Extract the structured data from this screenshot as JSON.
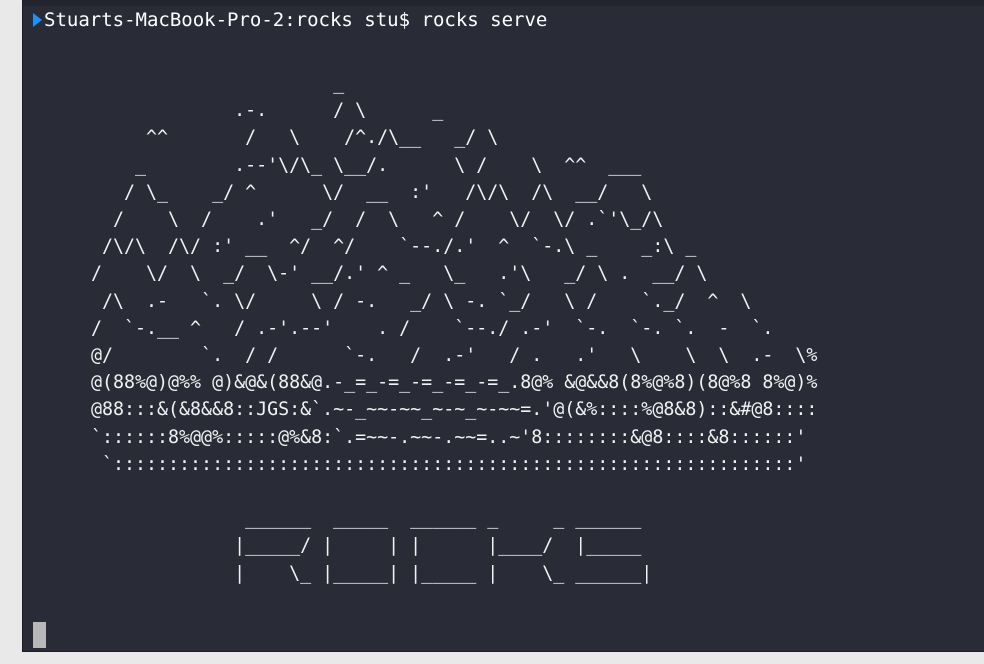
{
  "terminal": {
    "prompt": {
      "host": "Stuarts-MacBook-Pro-2:rocks stu$",
      "command": "rocks serve"
    },
    "art_lines": [
      "                      _",
      "             .-.      / \\      _",
      "     ^^       /   \\    /^./\\__   _/ \\",
      "    _        .--'\\/\\_ \\__/.      \\ /    \\  ^^  ___",
      "   / \\_    _/ ^      \\/  __  :'   /\\/\\  /\\  __/   \\",
      "  /    \\  /    .'   _/  /  \\   ^ /    \\/  \\/ .`'\\_/\\",
      " /\\/\\  /\\/ :' __  ^/  ^/    `--./.'  ^  `-.\\ _    _:\\ _",
      "/    \\/  \\  _/  \\-' __/.' ^ _   \\_   .'\\   _/ \\ .  __/ \\",
      " /\\  .-   `. \\/     \\ / -.   _/ \\ -. `_/   \\ /    `._/  ^  \\",
      "/  `-.__ ^   / .-'.--'    . /    `--./ .-'  `-.  `-. `.  -  `.",
      "@/        `.  / /      `-.   /  .-'   / .   .'   \\    \\  \\  .-  \\%",
      "@(88%@)@%% @)&@&(88&@.-_=_-=_-=_-=_-=_.8@% &@&&8(8%@%8)(8@%8 8%@)%",
      "@88:::&(&8&&8::JGS:&`.~-_~~-~~_~-~_~-~~=.'@(&%::::%@8&8)::&#@8::::",
      "`::::::8%@@%:::::@%&8:`.=~~-.~~-.~~=..~'8::::::::&@8::::&8::::::'",
      " `::::::::::::::::::::::::::::::::::::::::::::::::::::::::::::::'",
      "",
      "              ______  _____  ______ _     _ ______",
      "             |_____/ |     | |      |____/  |_____",
      "             |    \\_ |_____| |_____ |    \\_ ______|"
    ]
  }
}
